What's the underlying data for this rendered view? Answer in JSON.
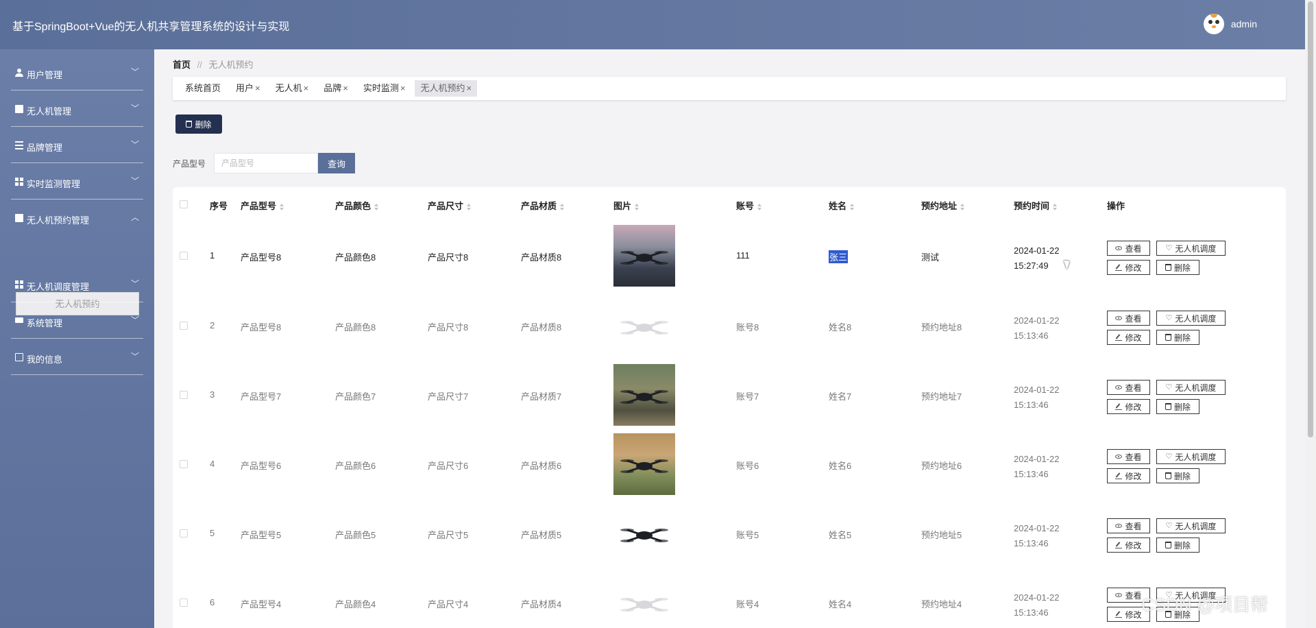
{
  "header": {
    "title": "基于SpringBoot+Vue的无人机共享管理系统的设计与实现",
    "username": "admin"
  },
  "sidebar": {
    "items": [
      {
        "label": "用户管理",
        "icon": "user-icon",
        "expanded": false
      },
      {
        "label": "无人机管理",
        "icon": "clipboard-icon",
        "expanded": false
      },
      {
        "label": "品牌管理",
        "icon": "list-icon",
        "expanded": false
      },
      {
        "label": "实时监测管理",
        "icon": "grid-icon",
        "expanded": false
      },
      {
        "label": "无人机预约管理",
        "icon": "clipboard-icon",
        "expanded": true
      },
      {
        "label": "无人机调度管理",
        "icon": "grid-icon",
        "expanded": false
      },
      {
        "label": "系统管理",
        "icon": "monitor-icon",
        "expanded": false
      },
      {
        "label": "我的信息",
        "icon": "card-icon",
        "expanded": false
      }
    ],
    "sub_item": "无人机预约"
  },
  "breadcrumb": {
    "home": "首页",
    "separator": "//",
    "current": "无人机预约"
  },
  "tabs": [
    {
      "label": "系统首页",
      "closable": false,
      "active": false
    },
    {
      "label": "用户",
      "closable": true,
      "active": false
    },
    {
      "label": "无人机",
      "closable": true,
      "active": false
    },
    {
      "label": "品牌",
      "closable": true,
      "active": false
    },
    {
      "label": "实时监测",
      "closable": true,
      "active": false
    },
    {
      "label": "无人机预约",
      "closable": true,
      "active": true
    }
  ],
  "toolbar": {
    "delete_label": "删除"
  },
  "search": {
    "label": "产品型号",
    "placeholder": "产品型号",
    "button": "查询"
  },
  "table": {
    "headers": {
      "index": "序号",
      "model": "产品型号",
      "color": "产品颜色",
      "size": "产品尺寸",
      "material": "产品材质",
      "image": "图片",
      "account": "账号",
      "name": "姓名",
      "address": "预约地址",
      "time": "预约时间",
      "actions": "操作"
    },
    "actions": {
      "view": "查看",
      "dispatch": "无人机调度",
      "edit": "修改",
      "delete": "删除"
    },
    "rows": [
      {
        "index": "1",
        "model": "产品型号8",
        "color": "产品颜色8",
        "size": "产品尺寸8",
        "material": "产品材质8",
        "image": "drone-photo-dark",
        "account": "111",
        "name": "张三",
        "address": "测试",
        "time": "2024-01-22 15:27:49"
      },
      {
        "index": "2",
        "model": "产品型号8",
        "color": "产品颜色8",
        "size": "产品尺寸8",
        "material": "产品材质8",
        "image": "drone-photo-white-plane",
        "account": "账号8",
        "name": "姓名8",
        "address": "预约地址8",
        "time": "2024-01-22 15:13:46"
      },
      {
        "index": "3",
        "model": "产品型号7",
        "color": "产品颜色7",
        "size": "产品尺寸7",
        "material": "产品材质7",
        "image": "drone-photo-outdoor",
        "account": "账号7",
        "name": "姓名7",
        "address": "预约地址7",
        "time": "2024-01-22 15:13:46"
      },
      {
        "index": "4",
        "model": "产品型号6",
        "color": "产品颜色6",
        "size": "产品尺寸6",
        "material": "产品材质6",
        "image": "drone-photo-indoor",
        "account": "账号6",
        "name": "姓名6",
        "address": "预约地址6",
        "time": "2024-01-22 15:13:46"
      },
      {
        "index": "5",
        "model": "产品型号5",
        "color": "产品颜色5",
        "size": "产品尺寸5",
        "material": "产品材质5",
        "image": "drone-photo-black",
        "account": "账号5",
        "name": "姓名5",
        "address": "预约地址5",
        "time": "2024-01-22 15:13:46"
      },
      {
        "index": "6",
        "model": "产品型号4",
        "color": "产品颜色4",
        "size": "产品尺寸4",
        "material": "产品材质4",
        "image": "drone-photo-white",
        "account": "账号4",
        "name": "姓名4",
        "address": "预约地址4",
        "time": "2024-01-22 15:13:46"
      }
    ]
  },
  "watermark": "CSDN @项目帮",
  "colors": {
    "header": "#5a6f99",
    "sidebar": "#6a7ea8",
    "primary_dark": "#23304f",
    "selection": "#2f5bd0"
  }
}
